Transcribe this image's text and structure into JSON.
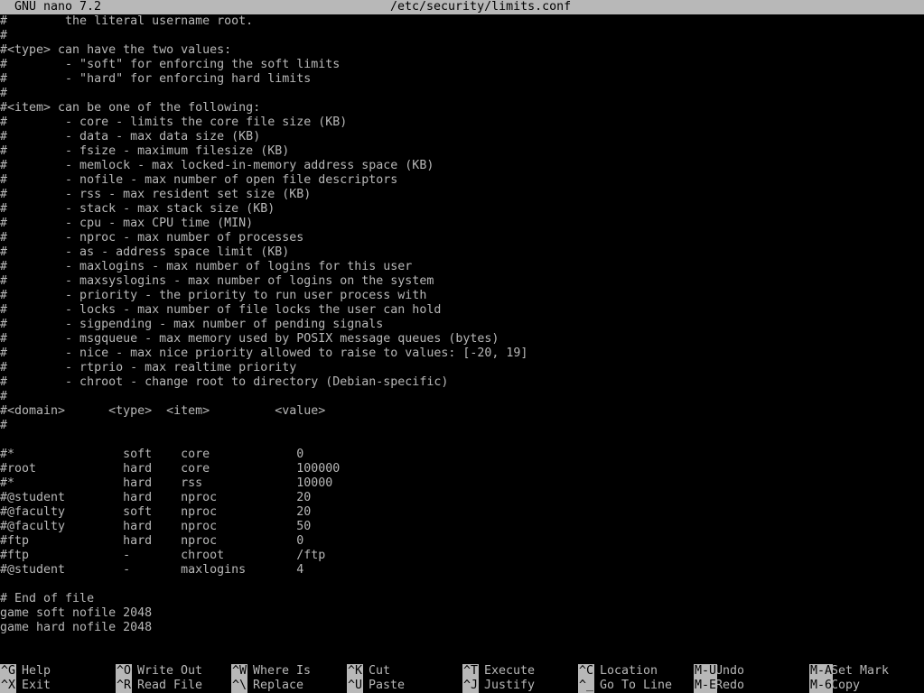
{
  "title_bar": {
    "app": "GNU nano 7.2",
    "file": "/etc/security/limits.conf"
  },
  "lines": [
    "#        the literal username root.",
    "#",
    "#<type> can have the two values:",
    "#        - \"soft\" for enforcing the soft limits",
    "#        - \"hard\" for enforcing hard limits",
    "#",
    "#<item> can be one of the following:",
    "#        - core - limits the core file size (KB)",
    "#        - data - max data size (KB)",
    "#        - fsize - maximum filesize (KB)",
    "#        - memlock - max locked-in-memory address space (KB)",
    "#        - nofile - max number of open file descriptors",
    "#        - rss - max resident set size (KB)",
    "#        - stack - max stack size (KB)",
    "#        - cpu - max CPU time (MIN)",
    "#        - nproc - max number of processes",
    "#        - as - address space limit (KB)",
    "#        - maxlogins - max number of logins for this user",
    "#        - maxsyslogins - max number of logins on the system",
    "#        - priority - the priority to run user process with",
    "#        - locks - max number of file locks the user can hold",
    "#        - sigpending - max number of pending signals",
    "#        - msgqueue - max memory used by POSIX message queues (bytes)",
    "#        - nice - max nice priority allowed to raise to values: [-20, 19]",
    "#        - rtprio - max realtime priority",
    "#        - chroot - change root to directory (Debian-specific)",
    "#",
    "#<domain>      <type>  <item>         <value>",
    "#",
    "",
    "#*               soft    core            0",
    "#root            hard    core            100000",
    "#*               hard    rss             10000",
    "#@student        hard    nproc           20",
    "#@faculty        soft    nproc           20",
    "#@faculty        hard    nproc           50",
    "#ftp             hard    nproc           0",
    "#ftp             -       chroot          /ftp",
    "#@student        -       maxlogins       4",
    "",
    "# End of file",
    "game soft nofile 2048",
    "game hard nofile 2048",
    ""
  ],
  "shortcuts": [
    {
      "top_key": "^G",
      "top_label": "Help",
      "bottom_key": "^X",
      "bottom_label": "Exit"
    },
    {
      "top_key": "^O",
      "top_label": "Write Out",
      "bottom_key": "^R",
      "bottom_label": "Read File"
    },
    {
      "top_key": "^W",
      "top_label": "Where Is",
      "bottom_key": "^\\",
      "bottom_label": "Replace"
    },
    {
      "top_key": "^K",
      "top_label": "Cut",
      "bottom_key": "^U",
      "bottom_label": "Paste"
    },
    {
      "top_key": "^T",
      "top_label": "Execute",
      "bottom_key": "^J",
      "bottom_label": "Justify"
    },
    {
      "top_key": "^C",
      "top_label": "Location",
      "bottom_key": "^_",
      "bottom_label": "Go To Line"
    },
    {
      "top_key": "M-U",
      "top_label": "Undo",
      "bottom_key": "M-E",
      "bottom_label": "Redo"
    },
    {
      "top_key": "M-A",
      "top_label": "Set Mark",
      "bottom_key": "M-6",
      "bottom_label": "Copy"
    }
  ],
  "colors": {
    "background": "#000000",
    "foreground": "#b8b8b8",
    "inverse_bg": "#b8b8b8",
    "inverse_fg": "#000000"
  }
}
